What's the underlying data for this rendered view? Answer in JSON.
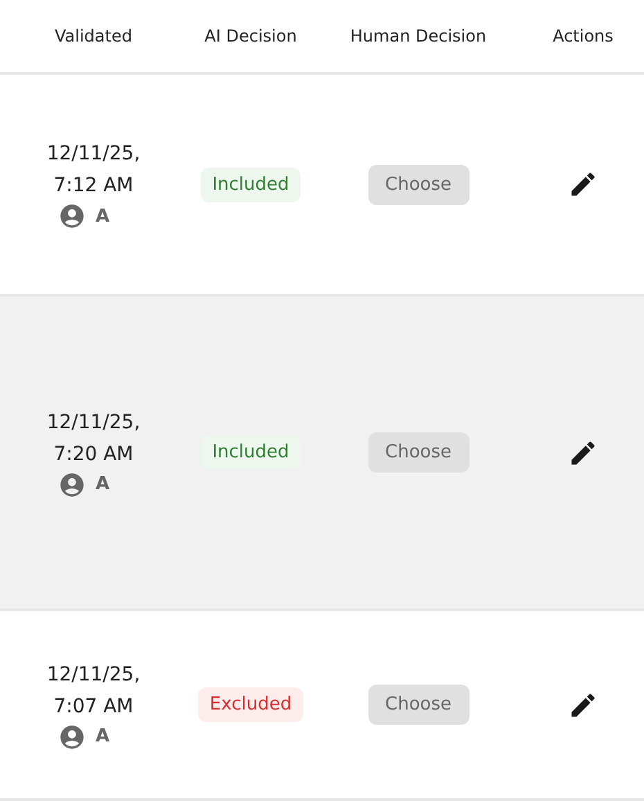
{
  "table": {
    "columns": [
      "Validated",
      "AI Decision",
      "Human Decision",
      "Actions"
    ],
    "rows": [
      {
        "validated": "12/11/25, 7:12 AM",
        "user": "A",
        "ai_decision": {
          "label": "Included",
          "kind": "included"
        },
        "human_decision": {
          "placeholder": "Choose"
        },
        "highlighted": false
      },
      {
        "validated": "12/11/25, 7:20 AM",
        "user": "A",
        "ai_decision": {
          "label": "Included",
          "kind": "included"
        },
        "human_decision": {
          "placeholder": "Choose"
        },
        "highlighted": true
      },
      {
        "validated": "12/11/25, 7:07 AM",
        "user": "A",
        "ai_decision": {
          "label": "Excluded",
          "kind": "excluded"
        },
        "human_decision": {
          "placeholder": "Choose"
        },
        "highlighted": false
      }
    ]
  }
}
